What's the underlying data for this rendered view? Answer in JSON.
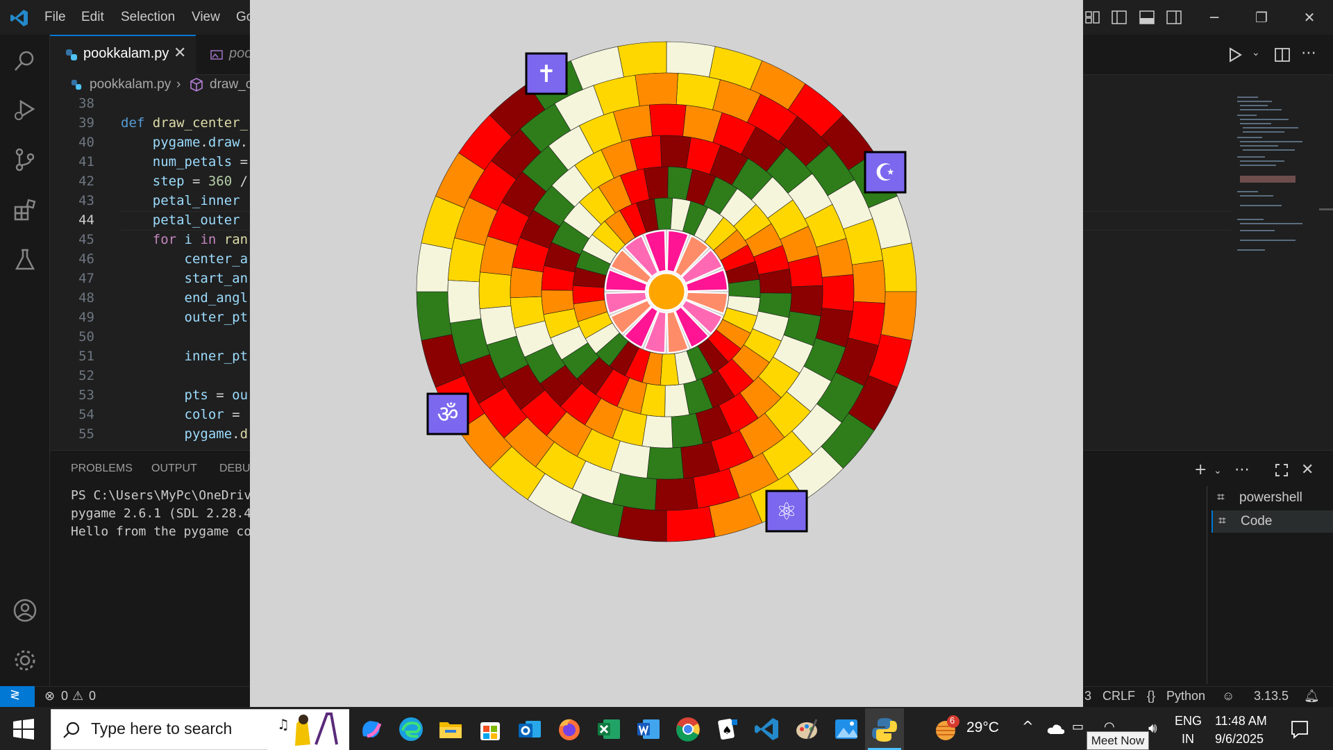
{
  "titlebar": {
    "menu": [
      "File",
      "Edit",
      "Selection",
      "View",
      "Go"
    ]
  },
  "tabs": {
    "active": "pookkalam.py",
    "second": "poo"
  },
  "breadcrumb": {
    "file": "pookkalam.py",
    "symbol": "draw_c"
  },
  "editor": {
    "active_line": 44,
    "line_numbers": [
      "38",
      "39",
      "40",
      "41",
      "42",
      "43",
      "44",
      "45",
      "46",
      "47",
      "48",
      "49",
      "50",
      "51",
      "52",
      "53",
      "54",
      "55"
    ]
  },
  "panel": {
    "tabs": [
      "PROBLEMS",
      "OUTPUT",
      "DEBU"
    ],
    "terminal_lines": [
      "PS C:\\Users\\MyPc\\OneDriv",
      "pygame 2.6.1 (SDL 2.28.4",
      "Hello from the pygame co"
    ],
    "terminals": [
      "powershell",
      "Code"
    ]
  },
  "statusbar": {
    "errors": "0",
    "warnings": "0",
    "eol": "CRLF",
    "language": "Python",
    "python_version": "3.13.5",
    "partial": "3"
  },
  "kolam": {
    "center_color": "#FFA500",
    "ring_colors": [
      "#f5f5dc",
      "#ffd700",
      "#ff8c00",
      "#ff0000",
      "#8b0000",
      "#2e7d1a"
    ],
    "inner_petal_colors": [
      "#ff1493",
      "#ff8c69",
      "#ff69b4"
    ],
    "symbols": [
      {
        "name": "cross",
        "glyph": "✝"
      },
      {
        "name": "crescent",
        "glyph": "☪"
      },
      {
        "name": "om",
        "glyph": "ॐ"
      },
      {
        "name": "atom",
        "glyph": "⚛"
      }
    ],
    "symbol_bg": "#7b68ee"
  },
  "taskbar": {
    "search_placeholder": "Type here to search",
    "weather_temp": "29°C",
    "weather_badge": "6",
    "lang_1": "ENG",
    "lang_2": "IN",
    "time": "11:48 AM",
    "date": "9/6/2025",
    "tooltip": "Meet Now"
  }
}
